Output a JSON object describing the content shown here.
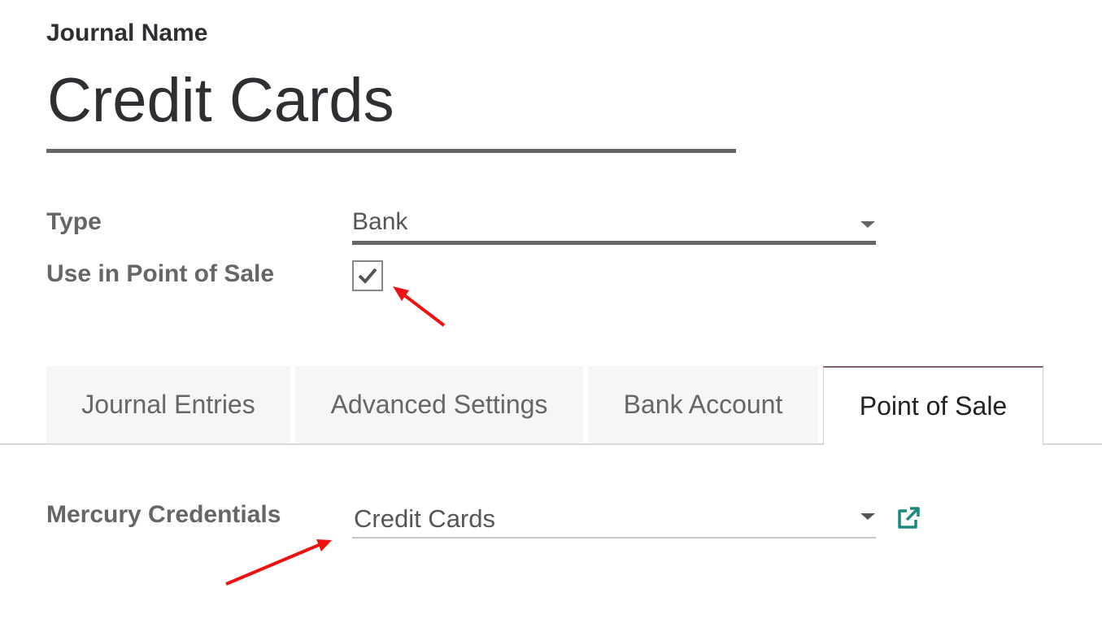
{
  "header": {
    "journal_label": "Journal Name",
    "journal_title": "Credit Cards"
  },
  "fields": {
    "type_label": "Type",
    "type_value": "Bank",
    "pos_label": "Use in Point of Sale",
    "pos_checked": true
  },
  "tabs": [
    {
      "label": "Journal Entries",
      "active": false
    },
    {
      "label": "Advanced Settings",
      "active": false
    },
    {
      "label": "Bank Account",
      "active": false
    },
    {
      "label": "Point of Sale",
      "active": true
    }
  ],
  "pos_tab": {
    "mercury_label": "Mercury Credentials",
    "mercury_value": "Credit Cards"
  },
  "colors": {
    "annotation_arrow": "#ee1111",
    "external_link_icon": "#1a8a80",
    "active_tab_accent": "#7c6074"
  },
  "icons": [
    "checkmark-icon",
    "caret-down-icon",
    "external-link-icon",
    "annotation-arrow"
  ]
}
